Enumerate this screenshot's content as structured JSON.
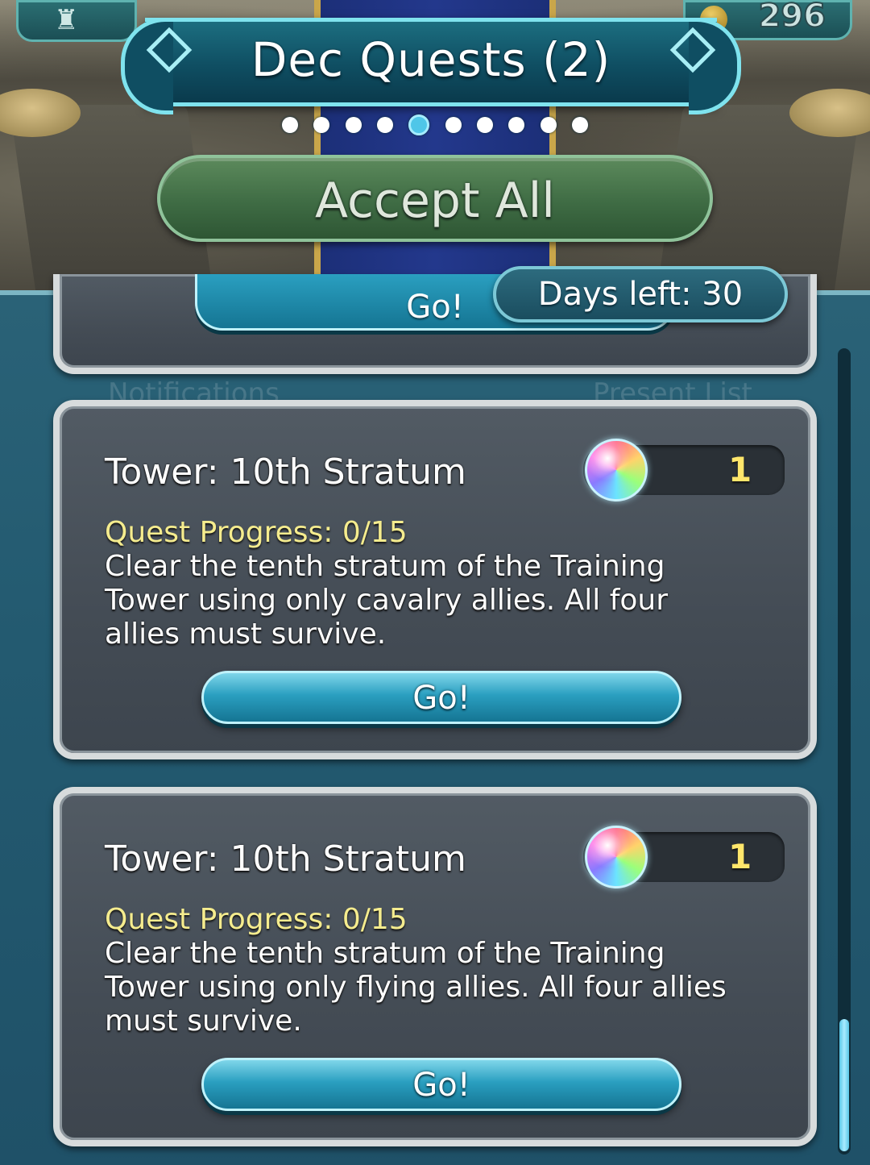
{
  "header": {
    "title": "Dec Quests (2)",
    "orb_count": "296",
    "page_dots": {
      "total": 10,
      "active_index": 4
    }
  },
  "accept_all_label": "Accept All",
  "days_left": "Days left: 30",
  "partial_card": {
    "go_label": "Go!"
  },
  "background_labels": [
    "Notifications",
    "Present List"
  ],
  "quests": [
    {
      "title": "Tower: 10th Stratum",
      "reward_icon": "orb-icon",
      "reward_count": "1",
      "progress": "Quest Progress: 0/15",
      "description": "Clear the tenth stratum of the Training Tower using only cavalry allies. All four allies must survive.",
      "go_label": "Go!"
    },
    {
      "title": "Tower: 10th Stratum",
      "reward_icon": "orb-icon",
      "reward_count": "1",
      "progress": "Quest Progress: 0/15",
      "description": "Clear the tenth stratum of the Training Tower using only flying allies. All four allies must survive.",
      "go_label": "Go!"
    }
  ],
  "colors": {
    "title_banner": "#0f4e62",
    "accept_button": "#3f6c44",
    "go_button": "#2a9fc0",
    "progress_text": "#f5ec8e",
    "reward_count": "#ffe66b"
  }
}
